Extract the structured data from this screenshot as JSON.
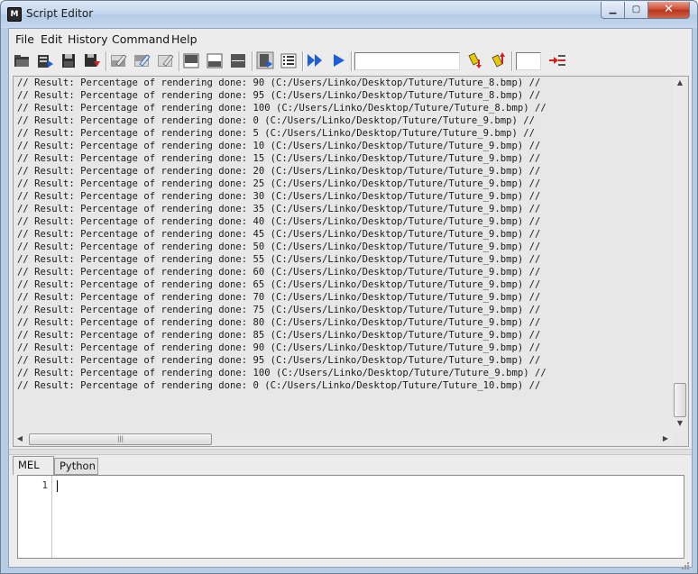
{
  "window": {
    "title": "Script Editor",
    "app_icon": "maya-icon",
    "controls": {
      "minimize": "minimize-icon",
      "maximize": "maximize-icon",
      "close": "close-icon"
    }
  },
  "menu": {
    "items": [
      {
        "label": "File"
      },
      {
        "label": "Edit"
      },
      {
        "label": "History"
      },
      {
        "label": "Command"
      },
      {
        "label": "Help"
      }
    ]
  },
  "toolbar": {
    "buttons": [
      "open-script-icon",
      "source-script-icon",
      "save-script-icon",
      "save-script-to-shelf-icon",
      "clear-history-icon",
      "clear-input-icon",
      "clear-all-icon",
      "show-history-only-icon",
      "show-input-only-icon",
      "show-both-icon",
      "echo-all-commands-icon",
      "show-line-numbers-icon",
      "execute-all-icon",
      "execute-icon",
      "search-down-icon",
      "search-up-icon",
      "goto-line-icon"
    ],
    "search_value": "",
    "line_value": ""
  },
  "history": {
    "lines": [
      "// Result: Percentage of rendering done: 90 (C:/Users/Linko/Desktop/Tuture/Tuture_8.bmp) //",
      "// Result: Percentage of rendering done: 95 (C:/Users/Linko/Desktop/Tuture/Tuture_8.bmp) //",
      "// Result: Percentage of rendering done: 100 (C:/Users/Linko/Desktop/Tuture/Tuture_8.bmp) //",
      "// Result: Percentage of rendering done: 0 (C:/Users/Linko/Desktop/Tuture/Tuture_9.bmp) //",
      "// Result: Percentage of rendering done: 5 (C:/Users/Linko/Desktop/Tuture/Tuture_9.bmp) //",
      "// Result: Percentage of rendering done: 10 (C:/Users/Linko/Desktop/Tuture/Tuture_9.bmp) //",
      "// Result: Percentage of rendering done: 15 (C:/Users/Linko/Desktop/Tuture/Tuture_9.bmp) //",
      "// Result: Percentage of rendering done: 20 (C:/Users/Linko/Desktop/Tuture/Tuture_9.bmp) //",
      "// Result: Percentage of rendering done: 25 (C:/Users/Linko/Desktop/Tuture/Tuture_9.bmp) //",
      "// Result: Percentage of rendering done: 30 (C:/Users/Linko/Desktop/Tuture/Tuture_9.bmp) //",
      "// Result: Percentage of rendering done: 35 (C:/Users/Linko/Desktop/Tuture/Tuture_9.bmp) //",
      "// Result: Percentage of rendering done: 40 (C:/Users/Linko/Desktop/Tuture/Tuture_9.bmp) //",
      "// Result: Percentage of rendering done: 45 (C:/Users/Linko/Desktop/Tuture/Tuture_9.bmp) //",
      "// Result: Percentage of rendering done: 50 (C:/Users/Linko/Desktop/Tuture/Tuture_9.bmp) //",
      "// Result: Percentage of rendering done: 55 (C:/Users/Linko/Desktop/Tuture/Tuture_9.bmp) //",
      "// Result: Percentage of rendering done: 60 (C:/Users/Linko/Desktop/Tuture/Tuture_9.bmp) //",
      "// Result: Percentage of rendering done: 65 (C:/Users/Linko/Desktop/Tuture/Tuture_9.bmp) //",
      "// Result: Percentage of rendering done: 70 (C:/Users/Linko/Desktop/Tuture/Tuture_9.bmp) //",
      "// Result: Percentage of rendering done: 75 (C:/Users/Linko/Desktop/Tuture/Tuture_9.bmp) //",
      "// Result: Percentage of rendering done: 80 (C:/Users/Linko/Desktop/Tuture/Tuture_9.bmp) //",
      "// Result: Percentage of rendering done: 85 (C:/Users/Linko/Desktop/Tuture/Tuture_9.bmp) //",
      "// Result: Percentage of rendering done: 90 (C:/Users/Linko/Desktop/Tuture/Tuture_9.bmp) //",
      "// Result: Percentage of rendering done: 95 (C:/Users/Linko/Desktop/Tuture/Tuture_9.bmp) //",
      "// Result: Percentage of rendering done: 100 (C:/Users/Linko/Desktop/Tuture/Tuture_9.bmp) //",
      "// Result: Percentage of rendering done: 0 (C:/Users/Linko/Desktop/Tuture/Tuture_10.bmp) //"
    ]
  },
  "tabs": [
    {
      "label": "MEL",
      "active": true
    },
    {
      "label": "Python",
      "active": false
    }
  ],
  "editor": {
    "line_numbers": [
      "1"
    ],
    "content": ""
  },
  "colors": {
    "execute_blue": "#1e5fd6",
    "search_yellow": "#e8c800",
    "search_red": "#d42020"
  }
}
